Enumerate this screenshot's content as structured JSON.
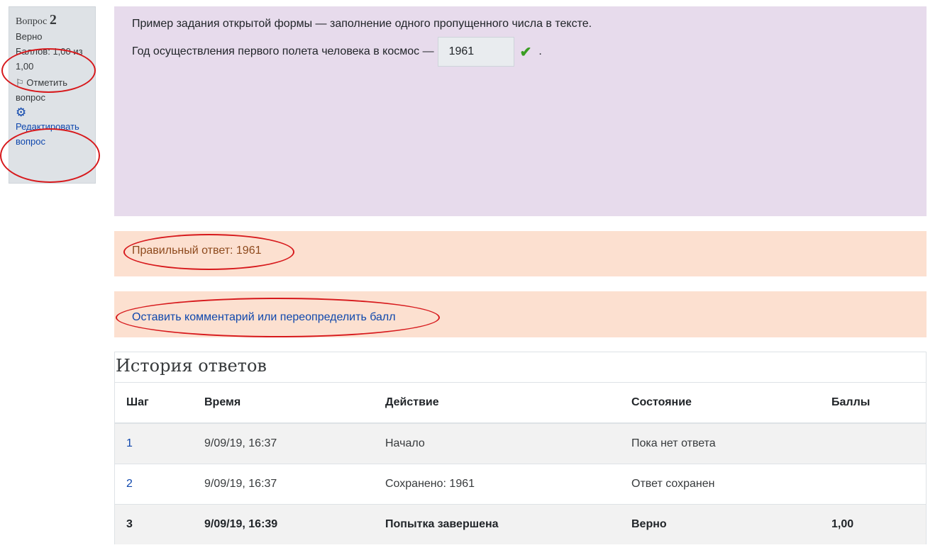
{
  "info": {
    "question_label": "Вопрос",
    "question_number": "2",
    "state": "Верно",
    "grade": "Баллов: 1,00 из 1,00",
    "flag_label": "Отметить вопрос",
    "edit_label": "Редактировать вопрос"
  },
  "formulation": {
    "intro": "Пример задания открытой формы — заполнение одного пропущенного числа в тексте.",
    "sentence": "Год осуществления первого полета человека в космос —",
    "answer_value": "1961",
    "sentence_end": "."
  },
  "feedback": {
    "right_answer": "Правильный ответ: 1961",
    "comment_link": "Оставить комментарий или переопределить балл"
  },
  "history": {
    "title": "История ответов",
    "columns": [
      "Шаг",
      "Время",
      "Действие",
      "Состояние",
      "Баллы"
    ],
    "rows": [
      {
        "step": "1",
        "time": "9/09/19, 16:37",
        "action": "Начало",
        "state": "Пока нет ответа",
        "marks": ""
      },
      {
        "step": "2",
        "time": "9/09/19, 16:37",
        "action": "Сохранено: 1961",
        "state": "Ответ сохранен",
        "marks": ""
      },
      {
        "step": "3",
        "time": "9/09/19, 16:39",
        "action": "Попытка завершена",
        "state": "Верно",
        "marks": "1,00"
      }
    ]
  },
  "colors": {
    "annotation": "#d7191c",
    "link": "#0f47ad",
    "correct": "#3a9d23"
  }
}
